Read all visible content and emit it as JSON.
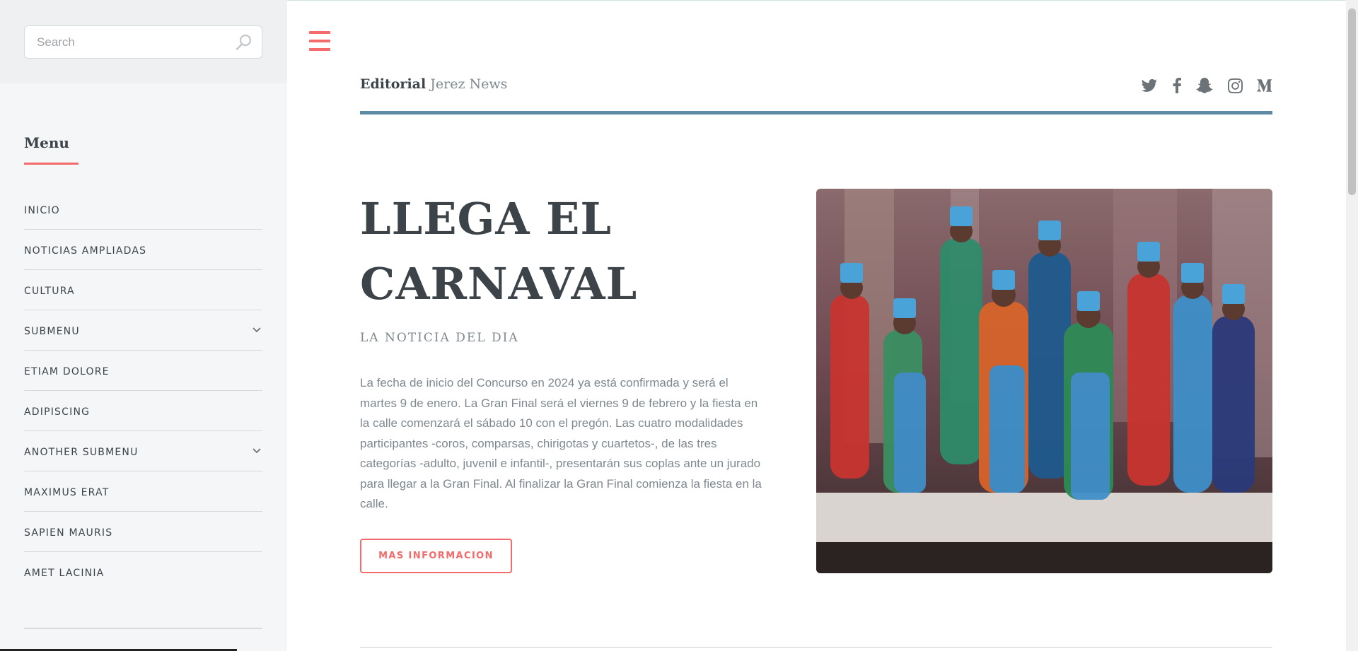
{
  "search": {
    "placeholder": "Search",
    "icon": "search-icon"
  },
  "sidebar": {
    "menu_title": "Menu",
    "items": [
      {
        "label": "INICIO",
        "has_submenu": false
      },
      {
        "label": "NOTICIAS AMPLIADAS",
        "has_submenu": false
      },
      {
        "label": "CULTURA",
        "has_submenu": false
      },
      {
        "label": "SUBMENU",
        "has_submenu": true
      },
      {
        "label": "ETIAM DOLORE",
        "has_submenu": false
      },
      {
        "label": "ADIPISCING",
        "has_submenu": false
      },
      {
        "label": "ANOTHER SUBMENU",
        "has_submenu": true
      },
      {
        "label": "MAXIMUS ERAT",
        "has_submenu": false
      },
      {
        "label": "SAPIEN MAURIS",
        "has_submenu": false
      },
      {
        "label": "AMET LACINIA",
        "has_submenu": false
      }
    ]
  },
  "header": {
    "logo_strong": "Editorial",
    "logo_rest": "Jerez News",
    "social_icons": [
      "twitter-icon",
      "facebook-icon",
      "snapchat-icon",
      "instagram-icon",
      "medium-icon"
    ]
  },
  "banner": {
    "headline_line1": "LLEGA EL",
    "headline_line2": "CARNAVAL",
    "subhead": "LA NOTICIA DEL DIA",
    "body": "La fecha de inicio del Concurso en 2024 ya está confirmada y será el martes 9 de enero. La Gran Final será el viernes 9 de febrero y la fiesta en la calle comenzará el sábado 10 con el pregón. Las cuatro modalidades participantes -coros, comparsas, chirigotas y cuartetos-, de las tres categorías -adulto, juvenil e infantil-, presentarán sus coplas ante un jurado para llegar a la Gran Final. Al finalizar la Gran Final comienza la fiesta en la calle.",
    "button_label": "MAS INFORMACION"
  },
  "colors": {
    "accent": "#f56a6a",
    "header_rule": "#5f8aa5",
    "text_dark": "#3d4449",
    "text_muted": "#7f888f",
    "sidebar_bg": "#f5f6f7"
  }
}
